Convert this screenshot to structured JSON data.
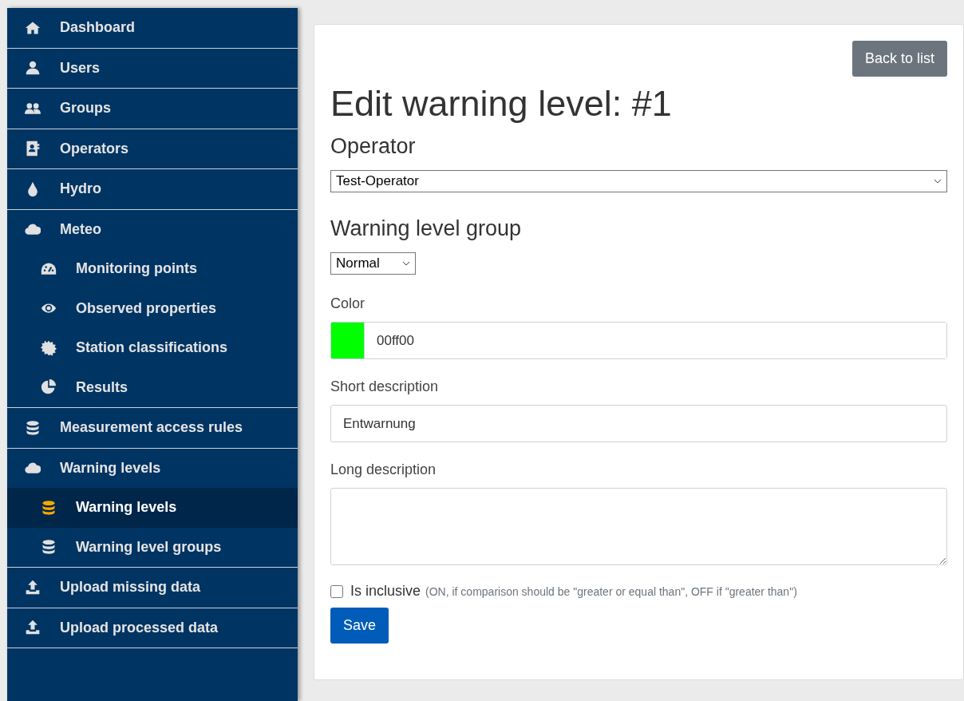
{
  "sidebar": {
    "items": [
      {
        "label": "Dashboard",
        "selected": false
      },
      {
        "label": "Users",
        "selected": false
      },
      {
        "label": "Groups",
        "selected": false
      },
      {
        "label": "Operators",
        "selected": false
      },
      {
        "label": "Hydro",
        "selected": false
      },
      {
        "label": "Meteo",
        "selected": false,
        "children": [
          {
            "label": "Monitoring points",
            "selected": false
          },
          {
            "label": "Observed properties",
            "selected": false
          },
          {
            "label": "Station classifications",
            "selected": false
          },
          {
            "label": "Results",
            "selected": false
          }
        ]
      },
      {
        "label": "Measurement access rules",
        "selected": false
      },
      {
        "label": "Warning levels",
        "selected": false,
        "children": [
          {
            "label": "Warning levels",
            "selected": true
          },
          {
            "label": "Warning level groups",
            "selected": false
          }
        ]
      },
      {
        "label": "Upload missing data",
        "selected": false
      },
      {
        "label": "Upload processed data",
        "selected": false
      }
    ]
  },
  "back_button": "Back to list",
  "title": "Edit warning level: #1",
  "operator": {
    "label": "Operator",
    "value": "Test-Operator"
  },
  "warning_level_group": {
    "label": "Warning level group",
    "value": "Normal"
  },
  "color": {
    "label": "Color",
    "value": "00ff00",
    "color": "#00ff00"
  },
  "short_description": {
    "label": "Short description",
    "value": "Entwarnung"
  },
  "long_description": {
    "label": "Long description"
  },
  "is_inclusive": {
    "label": "Is inclusive",
    "hint": "(ON, if comparison should be \"greater or equal than\", OFF if \"greater than\")",
    "checked": false
  },
  "save_button": "Save"
}
